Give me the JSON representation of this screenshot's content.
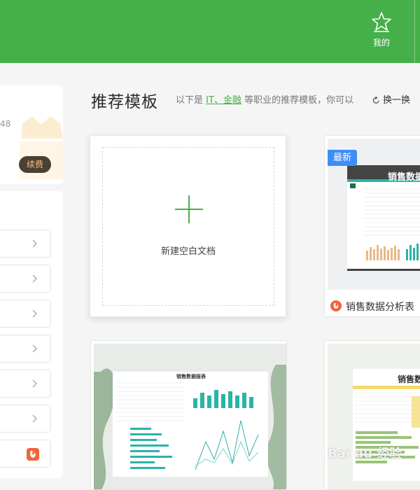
{
  "header": {
    "favorites_label": "我的",
    "favorites_icon": "star-outline-icon",
    "bg_color": "#45b049"
  },
  "left_panel": {
    "partial_number": "48",
    "renew_label": "续费"
  },
  "main": {
    "section_title": "推荐模板",
    "desc_prefix": "以下是",
    "desc_link": "IT、金融",
    "desc_suffix": "等职业的推荐模板，你可以",
    "refresh_label": "换一换"
  },
  "cards": {
    "new_doc_label": "新建空白文档",
    "template1_badge": "最新",
    "template1_name": "销售数据分析表",
    "template1_sheet_title": "销售数据",
    "template2_sheet_title": "销售数据报表",
    "template3_sheet_title": "销售数"
  },
  "watermark": "Bai du 经验"
}
